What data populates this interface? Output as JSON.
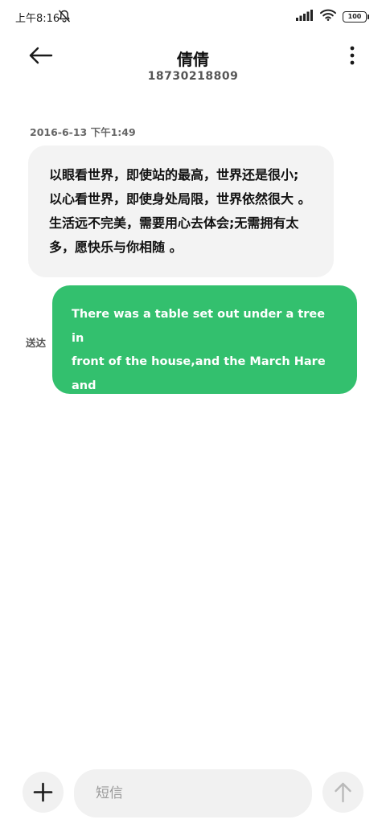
{
  "status_bar": {
    "time": "上午8:16",
    "battery": "100"
  },
  "header": {
    "contact_name": "倩倩",
    "contact_number": "18730218809"
  },
  "conversation": {
    "timestamp": "2016-6-13 下午1:49",
    "messages": [
      {
        "direction": "incoming",
        "text": "以眼看世界，即使站的最高，世界还是很小;\n以心看世界，即使身处局限，世界依然很大 。\n生活远不完美，需要用心去体会;无需拥有太\n多，愿快乐与你相随 。"
      },
      {
        "direction": "outgoing",
        "status": "送达",
        "text": "There was a table set out under a tree in\nfront of the house,and the March Hare and\nthe Hatter were having tea at it."
      }
    ]
  },
  "composer": {
    "placeholder": "短信"
  },
  "colors": {
    "outgoing_bubble": "#33c06e",
    "incoming_bubble": "#f3f3f3",
    "composer_bg": "#f1f1f1"
  }
}
